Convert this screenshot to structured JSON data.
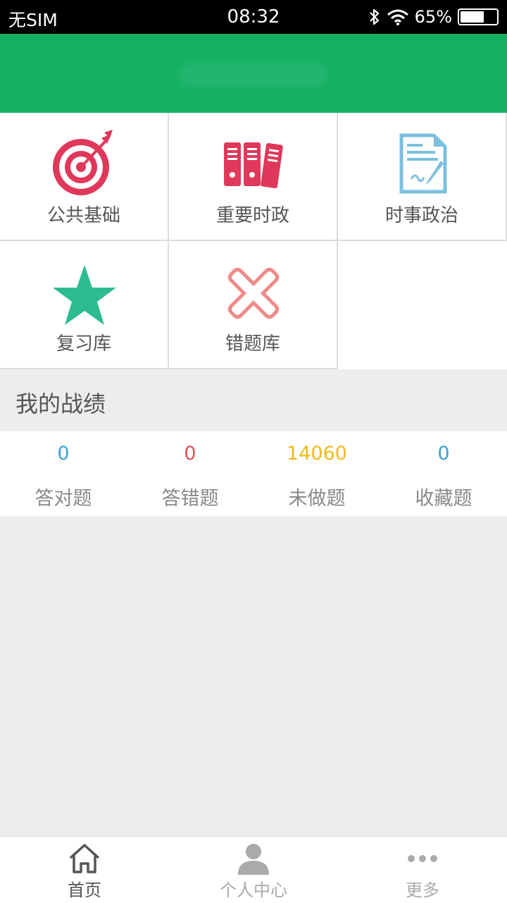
{
  "status_bar": {
    "carrier": "无SIM",
    "time": "08:32",
    "battery": "65%",
    "battery_level": 0.65
  },
  "menu": [
    {
      "label": "公共基础",
      "icon": "target-icon"
    },
    {
      "label": "重要时政",
      "icon": "binders-icon"
    },
    {
      "label": "时事政治",
      "icon": "document-icon"
    },
    {
      "label": "复习库",
      "icon": "star-icon"
    },
    {
      "label": "错题库",
      "icon": "cross-icon"
    }
  ],
  "stats": {
    "title": "我的战绩",
    "items": [
      {
        "value": "0",
        "label": "答对题",
        "color": "#3ba3d0"
      },
      {
        "value": "0",
        "label": "答错题",
        "color": "#e2525b"
      },
      {
        "value": "14060",
        "label": "未做题",
        "color": "#f0b91c"
      },
      {
        "value": "0",
        "label": "收藏题",
        "color": "#3ba3d0"
      }
    ]
  },
  "tabs": [
    {
      "label": "首页",
      "icon": "home-icon",
      "active": true
    },
    {
      "label": "个人中心",
      "icon": "person-icon",
      "active": false
    },
    {
      "label": "更多",
      "icon": "more-icon",
      "active": false
    }
  ],
  "colors": {
    "header": "#16b064",
    "active_tab": "#555555",
    "inactive_tab": "#aaaaaa"
  }
}
